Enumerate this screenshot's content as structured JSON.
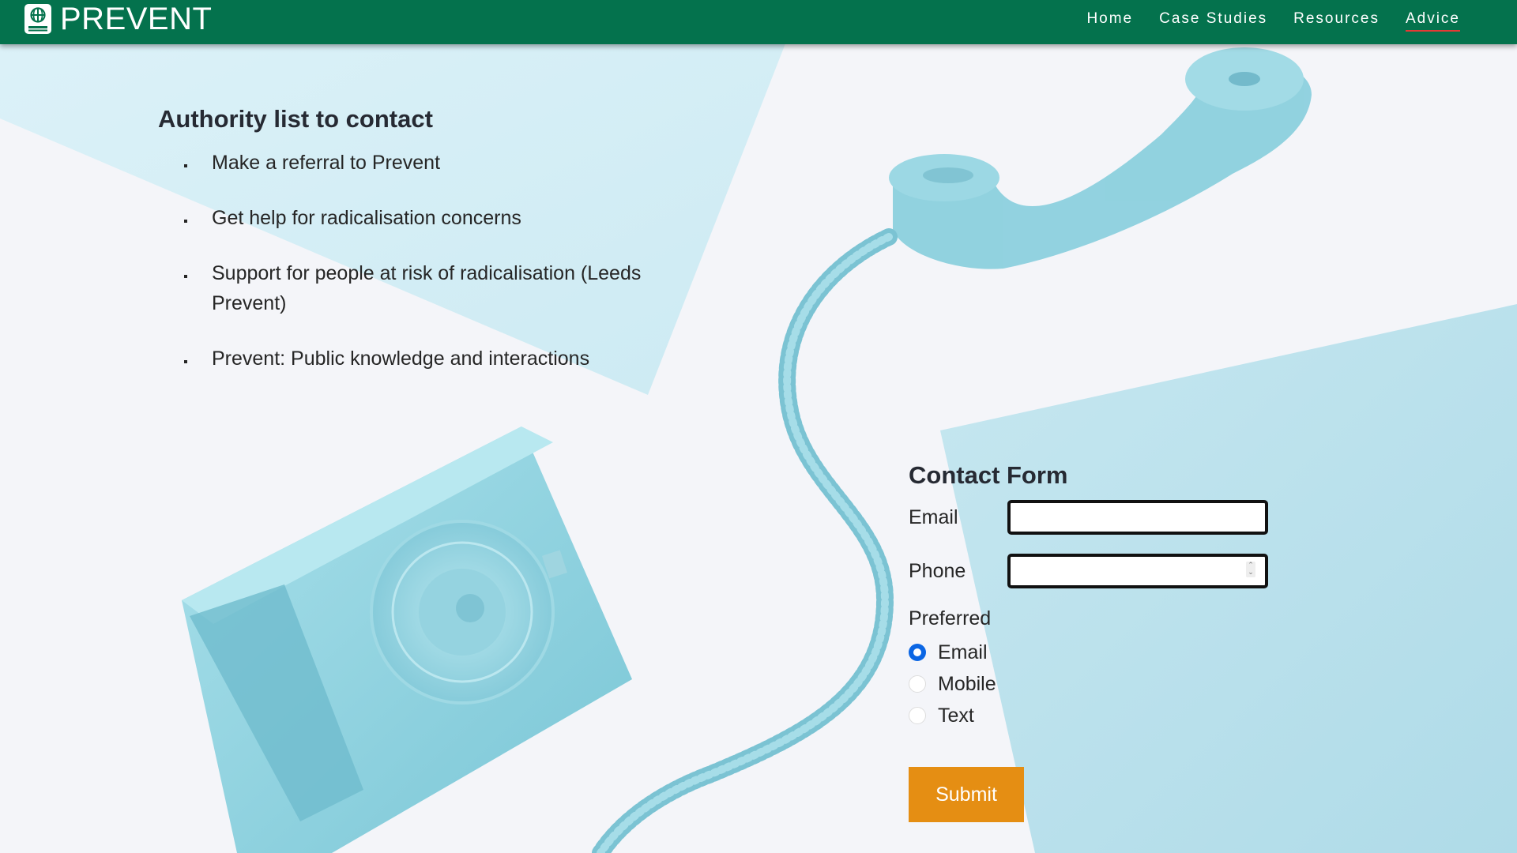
{
  "brand": {
    "name": "PREVENT",
    "icon": "globe-book-icon"
  },
  "nav": {
    "items": [
      "Home",
      "Case Studies",
      "Resources",
      "Advice"
    ],
    "active": "Advice"
  },
  "authority": {
    "title": "Authority list to contact",
    "items": [
      "Make a referral to Prevent",
      "Get help for radicalisation concerns",
      "Support for people at risk of radicalisation (Leeds Prevent)",
      "Prevent: Public knowledge and interactions"
    ]
  },
  "contact_form": {
    "title": "Contact Form",
    "email_label": "Email",
    "email_value": "",
    "phone_label": "Phone",
    "phone_value": "",
    "preferred_label": "Preferred",
    "options": [
      "Email",
      "Mobile",
      "Text"
    ],
    "selected": "Email",
    "submit_label": "Submit"
  },
  "colors": {
    "navbar": "#04724d",
    "nav_active_underline": "#e53935",
    "submit": "#e58e13",
    "radio_checked": "#0b66e4",
    "phone_blue": "#8ed1df"
  },
  "background": {
    "description_icon": "rotary-telephone-illustration"
  }
}
